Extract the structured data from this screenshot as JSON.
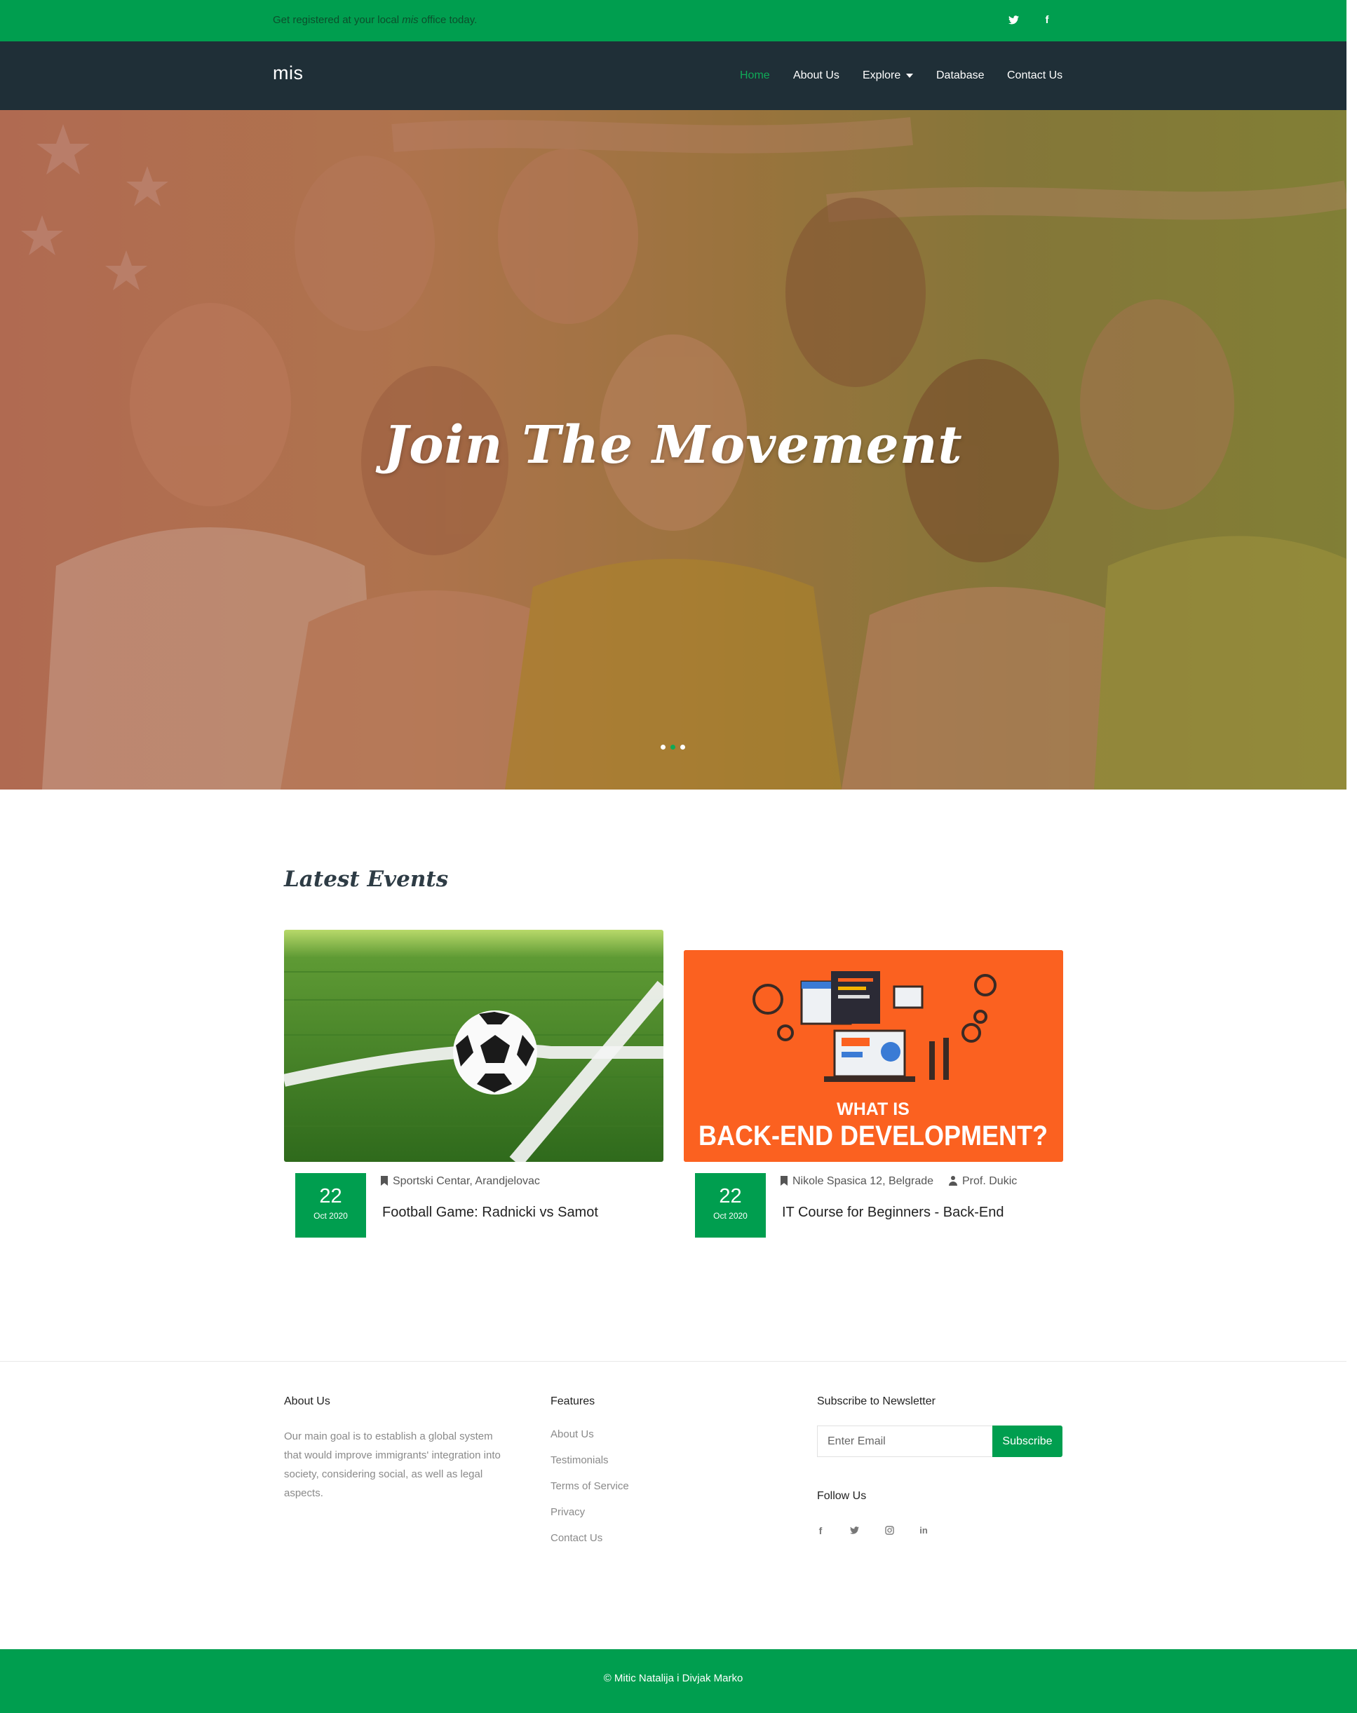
{
  "topbar": {
    "message_before": "Get registered at your local ",
    "message_italic": "mis",
    "message_after": " office today.",
    "social": [
      {
        "icon": "twitter-icon",
        "glyph": "🐦"
      },
      {
        "icon": "facebook-icon",
        "glyph": "f"
      }
    ]
  },
  "navbar": {
    "brand": "mis",
    "items": [
      {
        "label": "Home",
        "active": true
      },
      {
        "label": "About Us"
      },
      {
        "label": "Explore",
        "dropdown": true
      },
      {
        "label": "Database"
      },
      {
        "label": "Contact Us"
      }
    ]
  },
  "hero": {
    "title": "Join The Movement",
    "slides": 3,
    "active_slide": 2
  },
  "events": {
    "title": "Latest Events",
    "items": [
      {
        "day": "22",
        "month": "Oct 2020",
        "location": "Sportski Centar, Arandjelovac",
        "title": "Football Game: Radnicki vs Samot"
      },
      {
        "day": "22",
        "month": "Oct 2020",
        "location": "Nikole Spasica 12, Belgrade",
        "person": "Prof. Dukic",
        "title": "IT Course for Beginners - Back-End",
        "image_text_1": "WHAT IS",
        "image_text_2": "BACK-END DEVELOPMENT?"
      }
    ]
  },
  "footer": {
    "about": {
      "title": "About Us",
      "text": "Our main goal is to establish a global system that would improve immigrants' integration into society, considering social, as well as legal aspects."
    },
    "features": {
      "title": "Features",
      "links": [
        "About Us",
        "Testimonials",
        "Terms of Service",
        "Privacy",
        "Contact Us"
      ]
    },
    "newsletter": {
      "title": "Subscribe to Newsletter",
      "placeholder": "Enter Email",
      "button": "Subscribe"
    },
    "follow": {
      "title": "Follow Us",
      "icons": [
        {
          "name": "facebook-icon",
          "glyph": "f"
        },
        {
          "name": "twitter-icon",
          "glyph": "🐦"
        },
        {
          "name": "instagram-icon",
          "glyph": "◎"
        },
        {
          "name": "linkedin-icon",
          "glyph": "in"
        }
      ]
    },
    "copyright": "© Mitic Natalija i Divjak Marko"
  },
  "colors": {
    "brand_green": "#009e4f",
    "navbar": "#1f2f37",
    "active_link": "#0faa57"
  }
}
